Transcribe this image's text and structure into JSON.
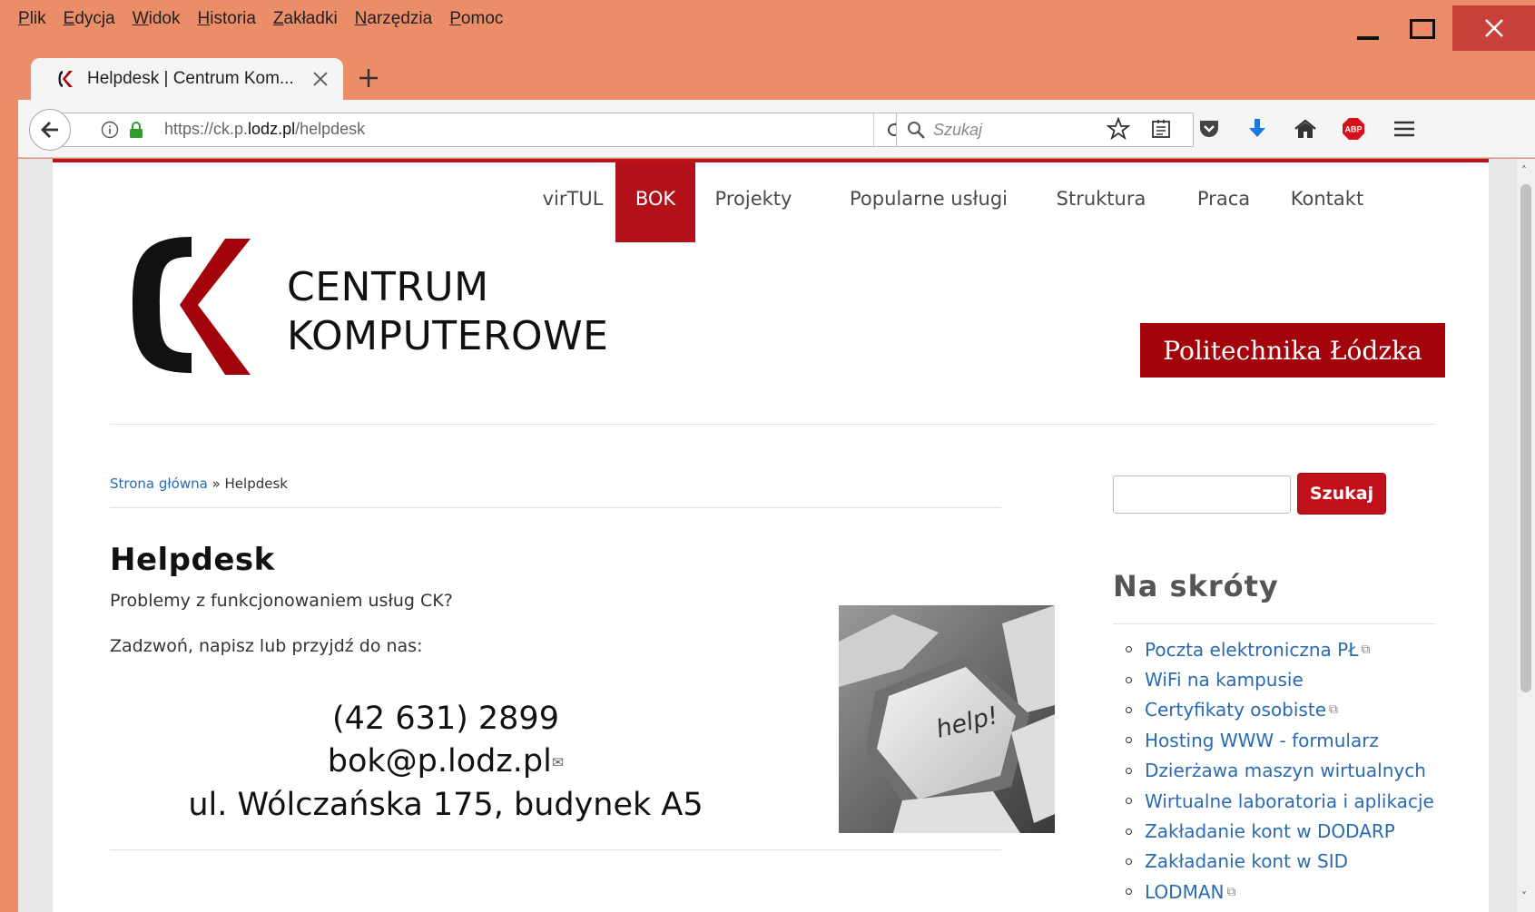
{
  "menubar": [
    "Plik",
    "Edycja",
    "Widok",
    "Historia",
    "Zakładki",
    "Narzędzia",
    "Pomoc"
  ],
  "tab": {
    "title": "Helpdesk | Centrum Kom...",
    "favicon": "ck-logo-icon"
  },
  "urlbar": {
    "prefix": "https://ck.p.",
    "domain": "lodz.pl",
    "path": "/helpdesk"
  },
  "searchbar": {
    "placeholder": "Szukaj"
  },
  "site": {
    "nav": [
      "virTUL",
      "BOK",
      "Projekty",
      "Popularne usługi",
      "Struktura",
      "Praca",
      "Kontakt"
    ],
    "nav_active": "BOK",
    "logo_line1": "CENTRUM",
    "logo_line2": "KOMPUTEROWE",
    "badge": "Politechnika Łódzka",
    "breadcrumb_home": "Strona główna",
    "breadcrumb_sep": " » ",
    "breadcrumb_current": "Helpdesk",
    "title": "Helpdesk",
    "para1": "Problemy z funkcjonowaniem usług CK?",
    "para2": "Zadzwoń, napisz lub przyjdź do nas:",
    "phone": "(42 631) 2899",
    "email": "bok@p.lodz.pl",
    "address": "ul. Wólczańska 175, budynek A5",
    "image_key_text": "help!"
  },
  "sidebar": {
    "search_button": "Szukaj",
    "shortcuts_title": "Na skróty",
    "shortcuts": [
      {
        "label": "Poczta elektroniczna PŁ",
        "external": true
      },
      {
        "label": "WiFi na kampusie",
        "external": false
      },
      {
        "label": "Certyfikaty osobiste",
        "external": true
      },
      {
        "label": "Hosting WWW - formularz",
        "external": false
      },
      {
        "label": "Dzierżawa maszyn wirtualnych",
        "external": false
      },
      {
        "label": "Wirtualne laboratoria i aplikacje",
        "external": false
      },
      {
        "label": "Zakładanie kont w DODARP",
        "external": false
      },
      {
        "label": "Zakładanie kont w SID",
        "external": false
      },
      {
        "label": "LODMAN",
        "external": true
      }
    ]
  },
  "colors": {
    "window_frame": "#ea8d68",
    "brand_red": "#b3111a",
    "link_blue": "#2a6ab0"
  }
}
